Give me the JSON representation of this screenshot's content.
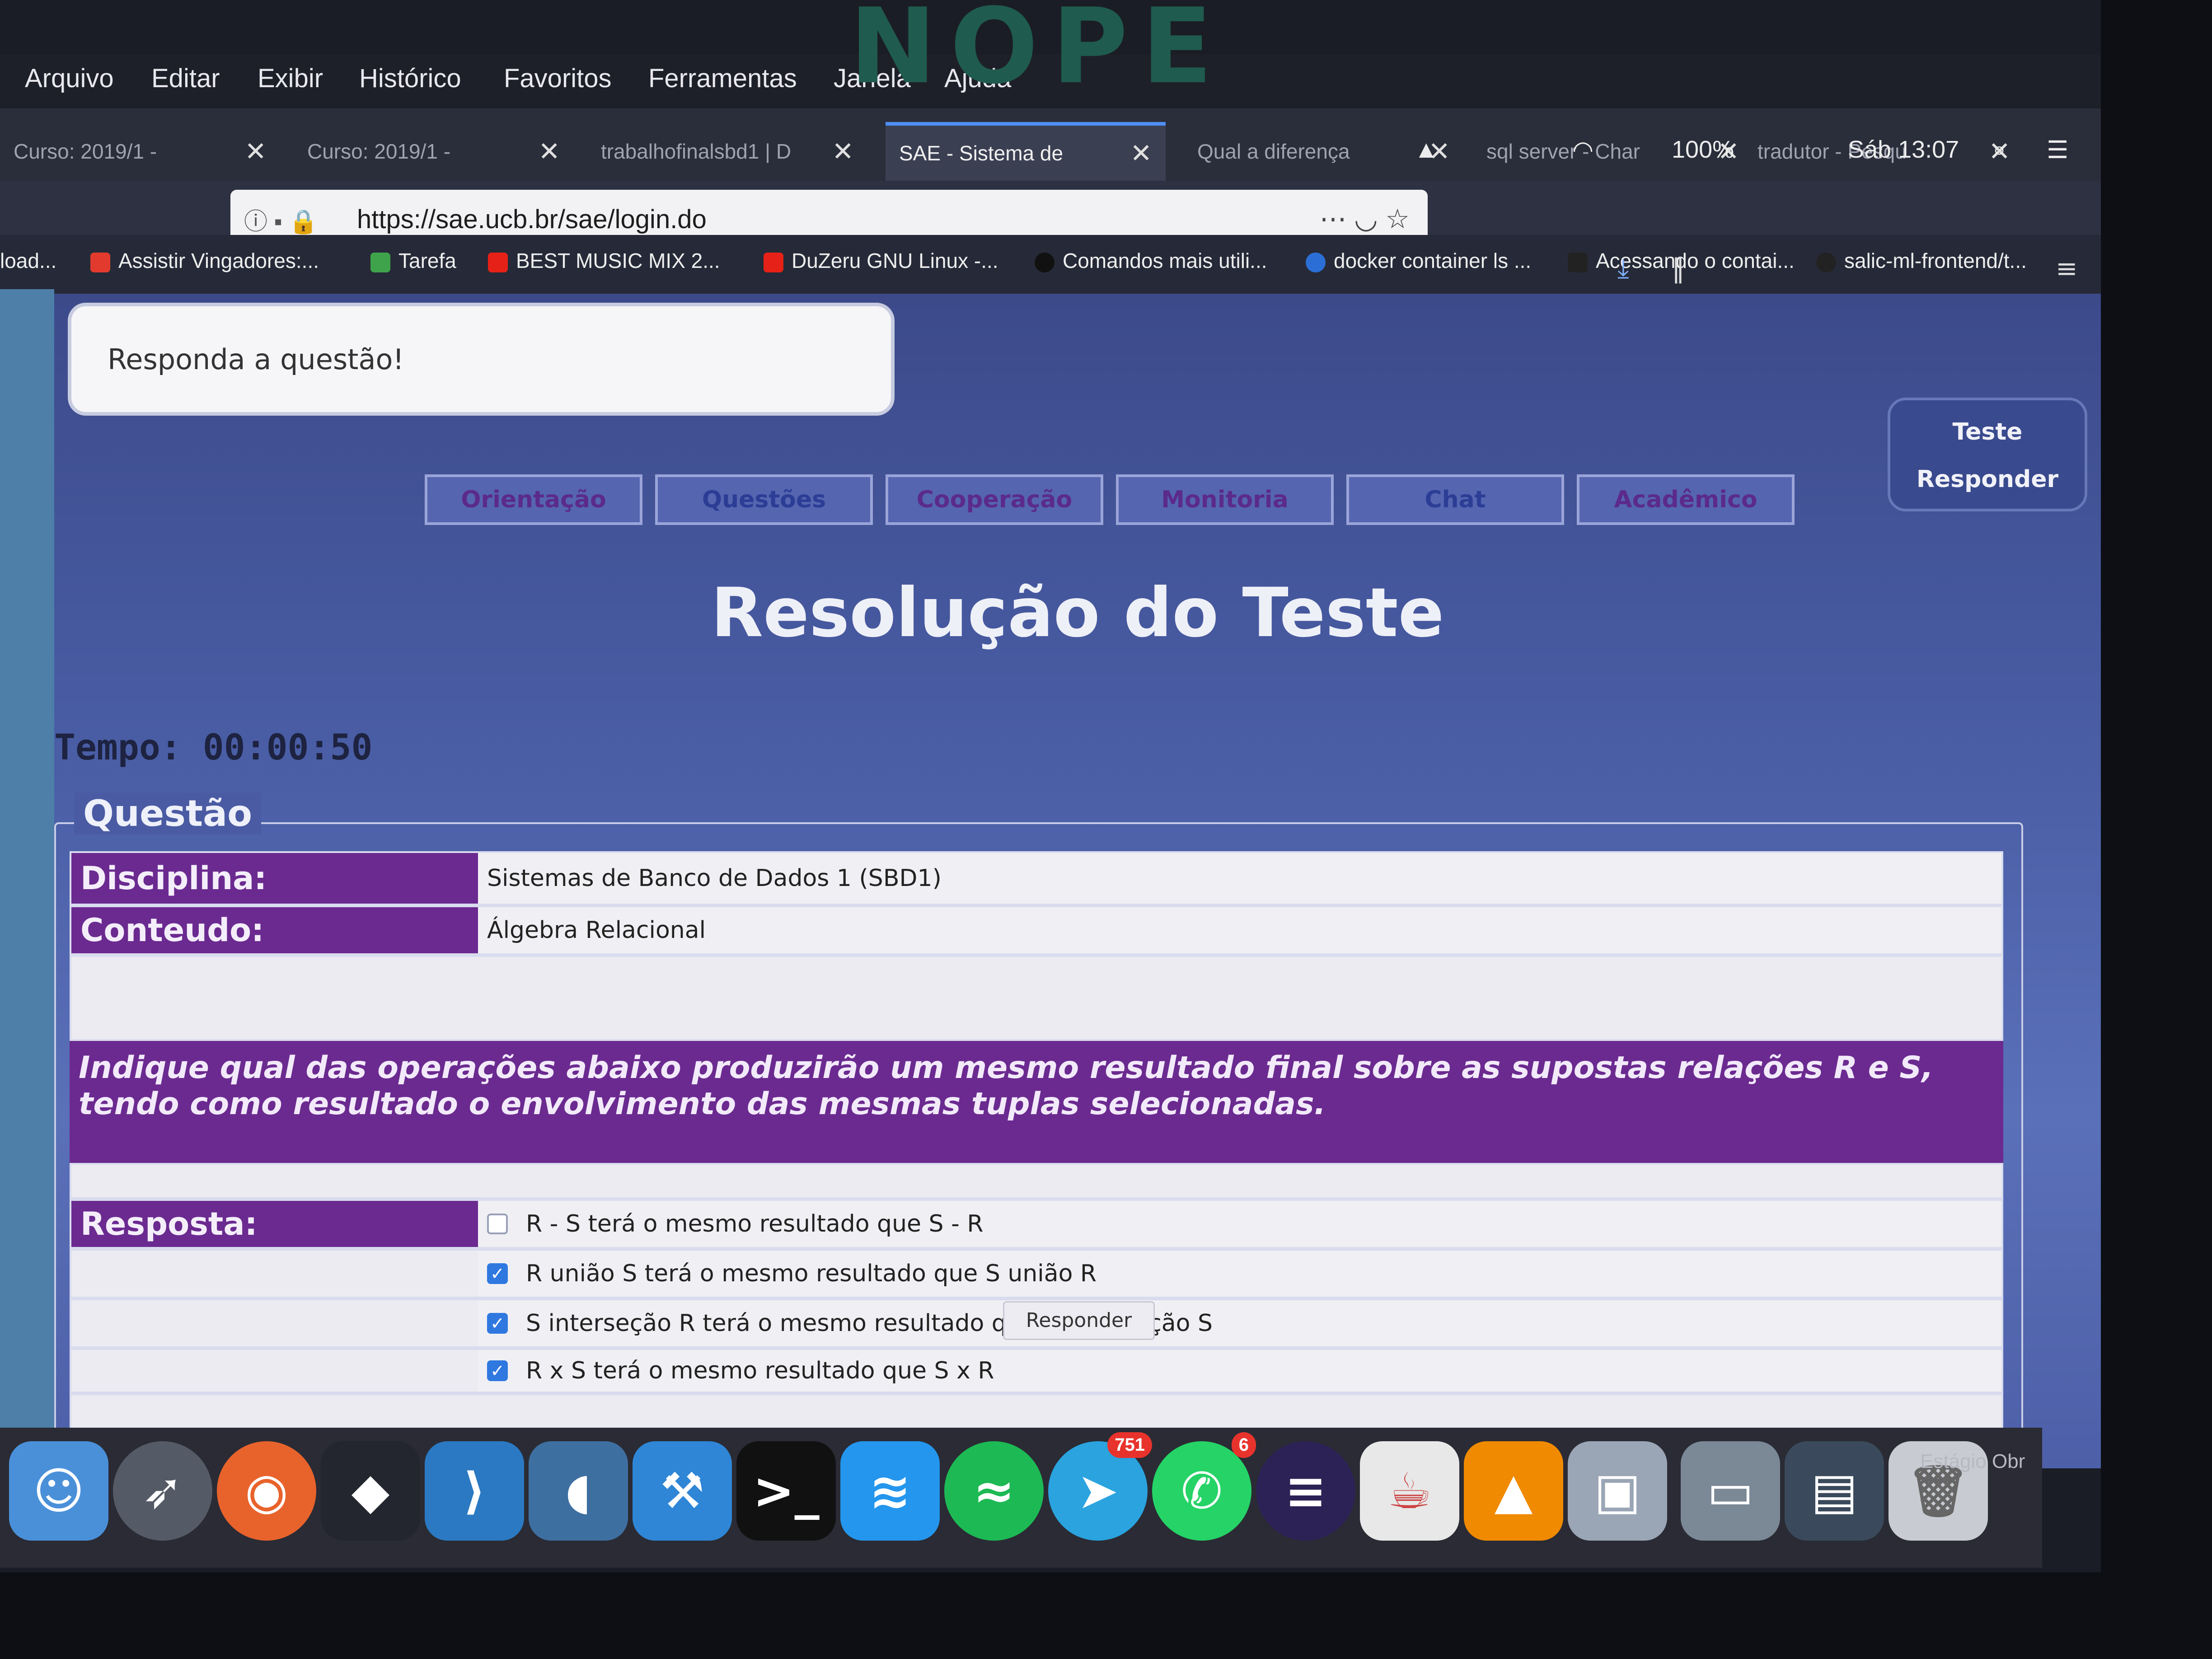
{
  "bezel": {
    "brand": "NOPE"
  },
  "menubar": {
    "items": [
      "Arquivo",
      "Editar",
      "Exibir",
      "Histórico",
      "Favoritos",
      "Ferramentas",
      "Janela",
      "Ajuda"
    ],
    "battery": "100%",
    "clock": "Sáb 13:07"
  },
  "tabs": [
    {
      "label": "Curso: 2019/1 -",
      "active": false
    },
    {
      "label": "Curso: 2019/1 -",
      "active": false
    },
    {
      "label": "trabalhofinalsbd1 | D",
      "active": false
    },
    {
      "label": "SAE - Sistema de",
      "active": true
    },
    {
      "label": "Qual a diferença",
      "active": false
    },
    {
      "label": "sql server - Char",
      "active": false
    },
    {
      "label": "tradutor - Pesqu",
      "active": false
    }
  ],
  "urlbar": {
    "url": "https://sae.ucb.br/sae/login.do"
  },
  "bookmarks": [
    {
      "label": "load...",
      "color": "#666666"
    },
    {
      "label": "Assistir Vingadores:...",
      "color": "#e23b2e"
    },
    {
      "label": "Tarefa",
      "color": "#3ea34a"
    },
    {
      "label": "BEST MUSIC MIX 2...",
      "color": "#e62117"
    },
    {
      "label": "DuZeru GNU Linux -...",
      "color": "#e62117"
    },
    {
      "label": "Comandos mais utili...",
      "color": "#111111"
    },
    {
      "label": "docker container ls ...",
      "color": "#2b6fd6"
    },
    {
      "label": "Acessando o contai...",
      "color": "#222222"
    },
    {
      "label": "salic-ml-frontend/t...",
      "color": "#222222"
    }
  ],
  "notice": {
    "text": "Responda a questão!"
  },
  "side_buttons": {
    "teste": "Teste",
    "responder": "Responder"
  },
  "nav_tabs": [
    "Orientação",
    "Questões",
    "Cooperação",
    "Monitoria",
    "Chat",
    "Acadêmico"
  ],
  "page_title": "Resolução do Teste",
  "timer": "Tempo: 00:00:50",
  "fieldset_legend": "Questão",
  "disciplina": {
    "label": "Disciplina:",
    "value": "Sistemas de Banco de Dados 1 (SBD1)"
  },
  "conteudo": {
    "label": "Conteudo:",
    "value": "Álgebra Relacional"
  },
  "question_text": "Indique qual das operações abaixo produzirão um mesmo resultado final sobre as supostas relações R e S, tendo como resultado o envolvimento das mesmas tuplas selecionadas.",
  "resposta_label": "Resposta:",
  "options": [
    {
      "text": "R - S terá o mesmo resultado que S - R",
      "checked": false
    },
    {
      "text": "R união S terá o mesmo resultado que S união R",
      "checked": true
    },
    {
      "text": "S interseção R terá o mesmo resultado que R interseção S",
      "checked": true
    },
    {
      "text": "R x S terá o mesmo resultado que S x R",
      "checked": true
    }
  ],
  "submit_label": "Responder",
  "dock": {
    "apps": [
      {
        "name": "finder-icon",
        "color": "#4a90d9"
      },
      {
        "name": "launchpad-icon",
        "color": "#555b66"
      },
      {
        "name": "firefox-icon",
        "color": "#e8632b"
      },
      {
        "name": "pycharm-icon",
        "color": "#23262e"
      },
      {
        "name": "vscode-icon",
        "color": "#2b79c2"
      },
      {
        "name": "mysql-workbench-icon",
        "color": "#3e6fa1"
      },
      {
        "name": "xcode-icon",
        "color": "#2f86d6"
      },
      {
        "name": "terminal-icon",
        "color": "#111111"
      },
      {
        "name": "docker-icon",
        "color": "#2496ed"
      },
      {
        "name": "spotify-icon",
        "color": "#1db954"
      },
      {
        "name": "telegram-icon",
        "color": "#2aa3df",
        "badge": "751"
      },
      {
        "name": "whatsapp-icon",
        "color": "#25d366",
        "badge": "6"
      },
      {
        "name": "eclipse-icon",
        "color": "#2c2255"
      },
      {
        "name": "java-icon",
        "color": "#e8e8e8"
      },
      {
        "name": "vlc-icon",
        "color": "#f08a00"
      },
      {
        "name": "preview-icon",
        "color": "#9aa6b6"
      },
      {
        "name": "screenshot-icon",
        "color": "#7b8896"
      },
      {
        "name": "downloads-icon",
        "color": "#3a4a5c"
      },
      {
        "name": "trash-icon",
        "color": "#c8ccd2"
      }
    ],
    "label": "Estágio Obr"
  }
}
